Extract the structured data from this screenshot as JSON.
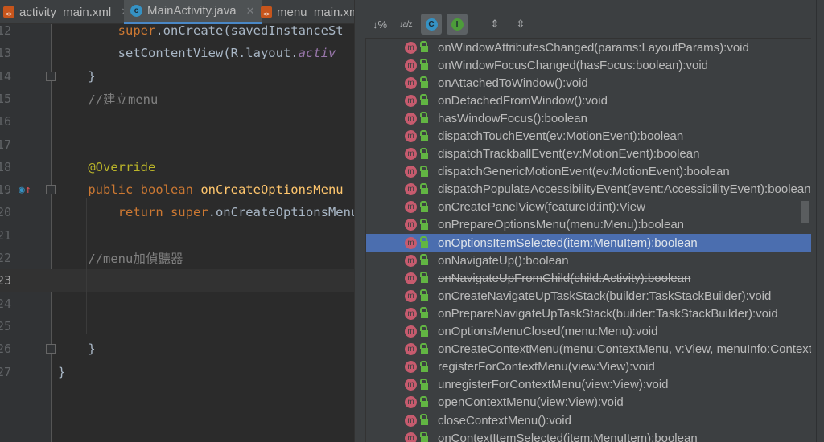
{
  "tabs": [
    {
      "label": "activity_main.xml",
      "icon": "xml-file-icon"
    },
    {
      "label": "MainActivity.java",
      "icon": "class-icon",
      "active": true
    },
    {
      "label": "menu_main.xml",
      "icon": "xml-file-icon"
    }
  ],
  "code": [
    {
      "n": "12",
      "parts": [
        [
          "kw",
          "        super"
        ],
        [
          "",
          "."
        ],
        [
          "",
          "onCreate(savedInstanceSt"
        ]
      ]
    },
    {
      "n": "13",
      "parts": [
        [
          "",
          "        setContentView(R.layout."
        ],
        [
          "it",
          "activ"
        ]
      ]
    },
    {
      "n": "14",
      "parts": [
        [
          "",
          "    }"
        ]
      ]
    },
    {
      "n": "15",
      "parts": [
        [
          "cm",
          "    //建立menu"
        ]
      ]
    },
    {
      "n": "16",
      "parts": []
    },
    {
      "n": "17",
      "parts": []
    },
    {
      "n": "18",
      "parts": [
        [
          "an",
          "    @Override"
        ]
      ]
    },
    {
      "n": "19",
      "parts": [
        [
          "kw",
          "    public boolean "
        ],
        [
          "fn",
          "onCreateOptionsMenu"
        ]
      ]
    },
    {
      "n": "20",
      "parts": [
        [
          "kw",
          "        return super"
        ],
        [
          "",
          ".onCreateOptionsMenu"
        ]
      ]
    },
    {
      "n": "21",
      "parts": []
    },
    {
      "n": "22",
      "parts": [
        [
          "cm",
          "    //menu加偵聽器"
        ]
      ]
    },
    {
      "n": "23",
      "parts": [],
      "current": true
    },
    {
      "n": "24",
      "parts": []
    },
    {
      "n": "25",
      "parts": []
    },
    {
      "n": "26",
      "parts": [
        [
          "",
          "    }"
        ]
      ]
    },
    {
      "n": "27",
      "parts": [
        [
          "",
          "}"
        ]
      ]
    }
  ],
  "toolbar": {
    "sort_visibility": "↓%",
    "sort_alpha": "↓a/z",
    "show_classes": "C",
    "show_inherited": "I",
    "expand_all": "expand-all-icon",
    "collapse_all": "collapse-all-icon"
  },
  "methods": [
    {
      "label": "onWindowAttributesChanged(params:LayoutParams):void"
    },
    {
      "label": "onWindowFocusChanged(hasFocus:boolean):void"
    },
    {
      "label": "onAttachedToWindow():void"
    },
    {
      "label": "onDetachedFromWindow():void"
    },
    {
      "label": "hasWindowFocus():boolean"
    },
    {
      "label": "dispatchTouchEvent(ev:MotionEvent):boolean"
    },
    {
      "label": "dispatchTrackballEvent(ev:MotionEvent):boolean"
    },
    {
      "label": "dispatchGenericMotionEvent(ev:MotionEvent):boolean"
    },
    {
      "label": "dispatchPopulateAccessibilityEvent(event:AccessibilityEvent):boolean"
    },
    {
      "label": "onCreatePanelView(featureId:int):View"
    },
    {
      "label": "onPrepareOptionsMenu(menu:Menu):boolean"
    },
    {
      "label": "onOptionsItemSelected(item:MenuItem):boolean",
      "selected": true
    },
    {
      "label": "onNavigateUp():boolean"
    },
    {
      "label": "onNavigateUpFromChild(child:Activity):boolean",
      "deprecated": true
    },
    {
      "label": "onCreateNavigateUpTaskStack(builder:TaskStackBuilder):void"
    },
    {
      "label": "onPrepareNavigateUpTaskStack(builder:TaskStackBuilder):void"
    },
    {
      "label": "onOptionsMenuClosed(menu:Menu):void"
    },
    {
      "label": "onCreateContextMenu(menu:ContextMenu, v:View, menuInfo:ContextMenuInfo):void"
    },
    {
      "label": "registerForContextMenu(view:View):void"
    },
    {
      "label": "unregisterForContextMenu(view:View):void"
    },
    {
      "label": "openContextMenu(view:View):void"
    },
    {
      "label": "closeContextMenu():void"
    },
    {
      "label": "onContextItemSelected(item:MenuItem):boolean"
    }
  ],
  "method_badge": "m"
}
